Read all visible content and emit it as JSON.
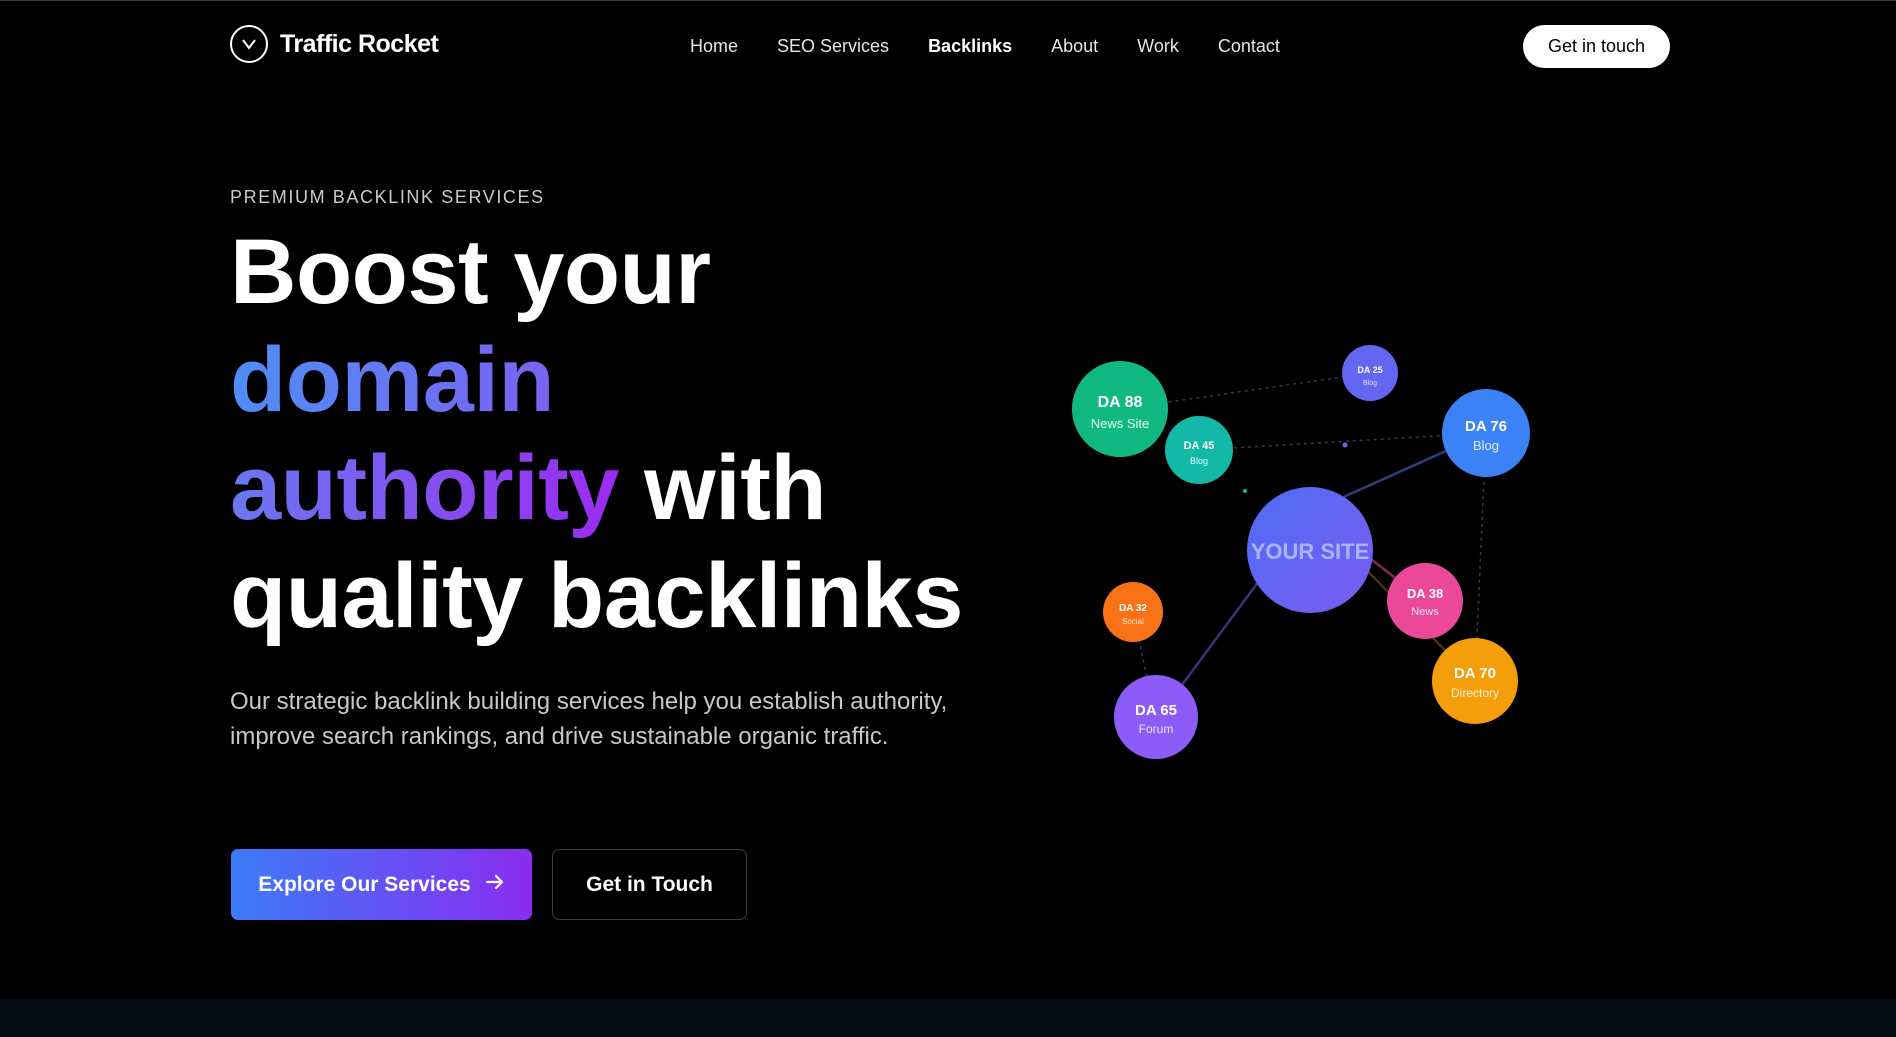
{
  "brand": {
    "name": "Traffic Rocket",
    "logo_glyph": "v"
  },
  "nav": {
    "items": [
      {
        "label": "Home",
        "active": false
      },
      {
        "label": "SEO Services",
        "active": false
      },
      {
        "label": "Backlinks",
        "active": true
      },
      {
        "label": "About",
        "active": false
      },
      {
        "label": "Work",
        "active": false
      },
      {
        "label": "Contact",
        "active": false
      }
    ],
    "cta_label": "Get in touch"
  },
  "hero": {
    "eyebrow": "PREMIUM BACKLINK SERVICES",
    "headline": {
      "line1": "Boost your",
      "line2": "domain",
      "line3_accent": "authority",
      "line3_rest": " with",
      "line4": "quality backlinks"
    },
    "description": "Our strategic backlink building services help you establish authority, improve search rankings, and drive sustainable organic traffic.",
    "primary_button": "Explore Our Services",
    "secondary_button": "Get in Touch"
  },
  "graph": {
    "center_label": "YOUR SITE",
    "nodes": [
      {
        "id": "news-site",
        "da": "DA 88",
        "type": "News Site",
        "color": "#10b981"
      },
      {
        "id": "blog-45",
        "da": "DA 45",
        "type": "Blog",
        "color": "#14b8a6"
      },
      {
        "id": "blog-25",
        "da": "DA 25",
        "type": "Blog",
        "color": "#6366f1"
      },
      {
        "id": "blog-76",
        "da": "DA 76",
        "type": "Blog",
        "color": "#3b82f6"
      },
      {
        "id": "news-38",
        "da": "DA 38",
        "type": "News",
        "color": "#ec4899"
      },
      {
        "id": "directory-70",
        "da": "DA 70",
        "type": "Directory",
        "color": "#f59e0b"
      },
      {
        "id": "social-32",
        "da": "DA 32",
        "type": "Social",
        "color": "#f97316"
      },
      {
        "id": "forum-65",
        "da": "DA 65",
        "type": "Forum",
        "color": "#8b5cf6"
      }
    ]
  },
  "colors": {
    "accent_blue": "#3b7bf7",
    "accent_purple": "#8a2cf0",
    "background": "#000000"
  }
}
